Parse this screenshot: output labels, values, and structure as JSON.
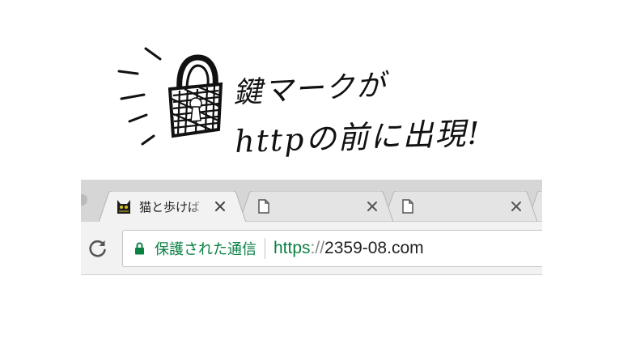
{
  "illustration": {
    "line1": "鍵マークが",
    "line2": "httpの前に出現!",
    "icon": "padlock-sketch-icon"
  },
  "browser": {
    "tabs": [
      {
        "title": "猫と歩けば",
        "favicon": "cat-favicon-icon",
        "active": true,
        "close": "close-icon"
      },
      {
        "title": "",
        "favicon": "blank-page-icon",
        "active": false,
        "close": "close-icon"
      },
      {
        "title": "",
        "favicon": "blank-page-icon",
        "active": false,
        "close": "close-icon"
      }
    ],
    "toolbar": {
      "reload_icon": "reload-icon",
      "security_label": "保護された通信",
      "url_scheme": "https",
      "url_separator": "://",
      "url_host": "2359-08.com"
    },
    "colors": {
      "secure_green": "#0b8043",
      "tab_strip": "#d6d6d6",
      "toolbar": "#f2f2f2"
    }
  }
}
